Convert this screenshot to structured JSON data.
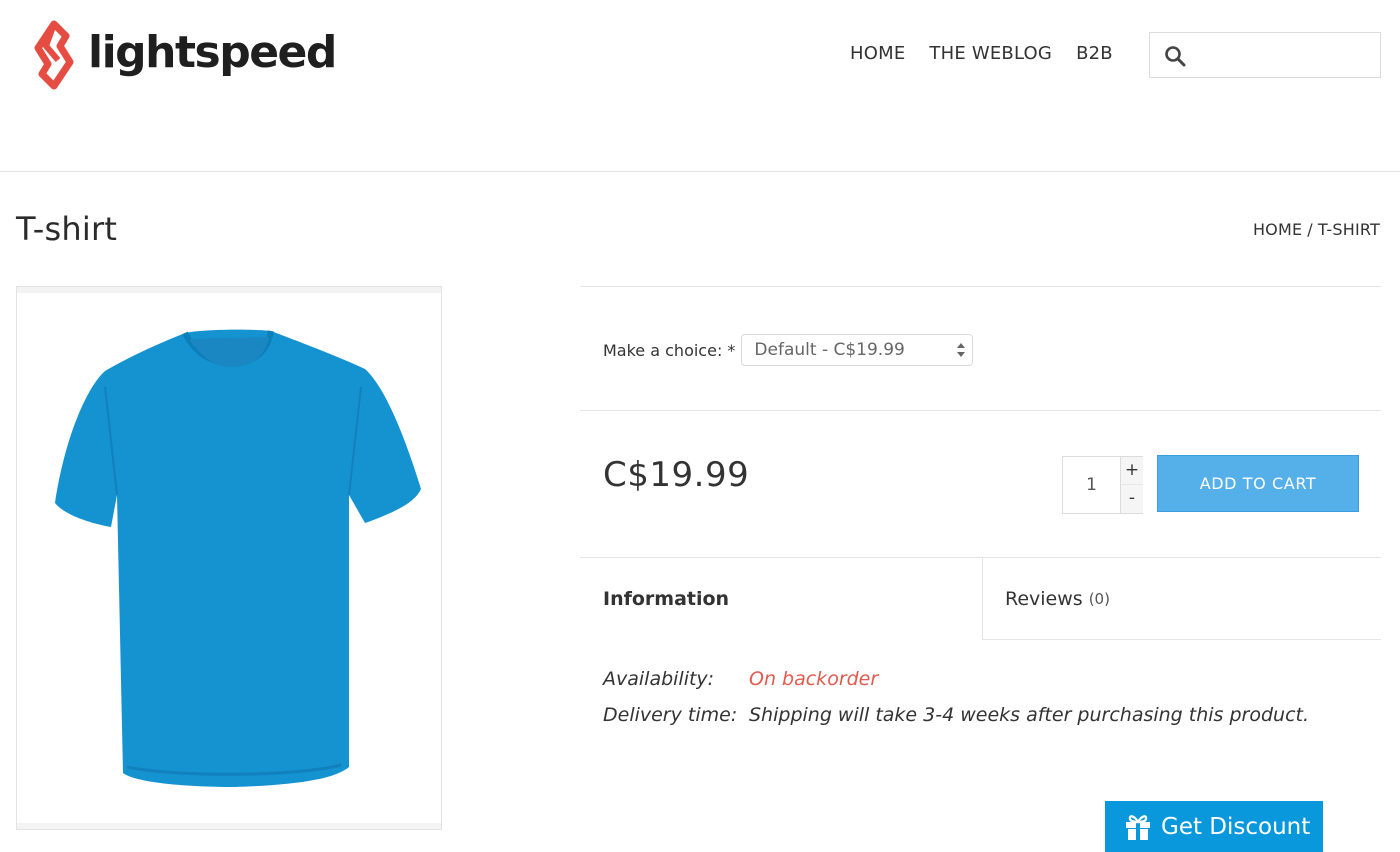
{
  "brand": {
    "name": "lightspeed",
    "accent": "#e54d42"
  },
  "nav": {
    "items": [
      "HOME",
      "THE WEBLOG",
      "B2B"
    ]
  },
  "search": {
    "icon": "search-icon",
    "value": ""
  },
  "page": {
    "title": "T-shirt"
  },
  "breadcrumb": {
    "home": "HOME",
    "separator": "/",
    "current": "T-SHIRT"
  },
  "product": {
    "image_alt": "Blue T-shirt",
    "image_color": "#1593d0",
    "choice_label": "Make a choice:",
    "choice_required": "*",
    "choice_selected": "Default - C$19.99",
    "price": "C$19.99",
    "quantity": "1",
    "qty_plus": "+",
    "qty_minus": "-",
    "add_to_cart": "ADD TO CART",
    "cart_color": "#55b0ea"
  },
  "tabs": {
    "information": "Information",
    "reviews": "Reviews",
    "reviews_count": "(0)"
  },
  "info": {
    "availability_label": "Availability:",
    "availability_value": "On backorder",
    "delivery_label": "Delivery time:",
    "delivery_value": "Shipping will take 3-4 weeks after purchasing this product."
  },
  "discount": {
    "label": "Get Discount",
    "icon": "gift-icon",
    "color": "#0a98dc"
  }
}
